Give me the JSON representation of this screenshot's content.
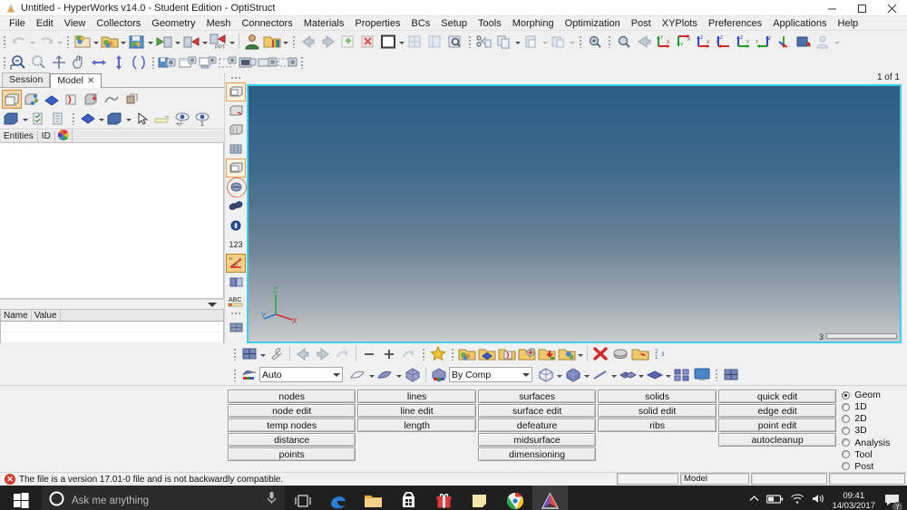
{
  "window": {
    "title": "Untitled - HyperWorks v14.0 - Student Edition - OptiStruct",
    "logo_icon": "altair-logo-icon",
    "minimize_label": "–",
    "maximize_label": "❐",
    "close_label": "✕"
  },
  "menu": {
    "items": [
      {
        "label": "File"
      },
      {
        "label": "Edit"
      },
      {
        "label": "View"
      },
      {
        "label": "Collectors"
      },
      {
        "label": "Geometry"
      },
      {
        "label": "Mesh"
      },
      {
        "label": "Connectors"
      },
      {
        "label": "Materials"
      },
      {
        "label": "Properties"
      },
      {
        "label": "BCs"
      },
      {
        "label": "Setup"
      },
      {
        "label": "Tools"
      },
      {
        "label": "Morphing"
      },
      {
        "label": "Optimization"
      },
      {
        "label": "Post"
      },
      {
        "label": "XYPlots"
      },
      {
        "label": "Preferences"
      },
      {
        "label": "Applications"
      },
      {
        "label": "Help"
      }
    ]
  },
  "toolbars": {
    "row1": [
      {
        "icon": "undo-icon"
      },
      {
        "icon": "redo-icon"
      },
      {
        "icon": "new-session-icon"
      },
      {
        "icon": "open-model-icon"
      },
      {
        "icon": "save-model-icon"
      },
      {
        "icon": "import-solver-deck-icon"
      },
      {
        "icon": "export-solver-deck-icon"
      },
      {
        "icon": "export-ppt-icon"
      },
      {
        "icon": "user-profile-icon"
      },
      {
        "icon": "color-palette-icon"
      },
      {
        "icon": "page-previous-icon"
      },
      {
        "icon": "page-next-icon"
      },
      {
        "icon": "page-add-icon"
      },
      {
        "icon": "page-delete-icon"
      },
      {
        "icon": "window-layout-icon"
      },
      {
        "icon": "window-tile-icon"
      },
      {
        "icon": "window-sync-icon"
      },
      {
        "icon": "window-overlay-icon"
      },
      {
        "icon": "cut-icon"
      },
      {
        "icon": "copy-icon"
      },
      {
        "icon": "paste-icon"
      },
      {
        "icon": "paste-special-icon"
      },
      {
        "icon": "fit-view-icon"
      }
    ],
    "row1b": [
      {
        "icon": "zoom-fit-icon"
      },
      {
        "icon": "view-previous-icon"
      },
      {
        "icon": "view-xy-icon"
      },
      {
        "icon": "view-yx-icon"
      },
      {
        "icon": "view-zx-icon"
      },
      {
        "icon": "view-xz-icon"
      },
      {
        "icon": "view-zy-icon"
      },
      {
        "icon": "view-yz-icon"
      },
      {
        "icon": "view-iso-icon"
      },
      {
        "icon": "rotate-view-icon"
      },
      {
        "icon": "user-view-icon"
      }
    ],
    "row2": [
      {
        "icon": "zoom-out-icon"
      },
      {
        "icon": "zoom-in-icon"
      },
      {
        "icon": "fit-icon"
      },
      {
        "icon": "pan-icon"
      },
      {
        "icon": "rotate-horizontal-icon"
      },
      {
        "icon": "rotate-vertical-icon"
      },
      {
        "icon": "rotate-free-icon"
      },
      {
        "icon": "capture-save-icon"
      },
      {
        "icon": "capture-window-icon"
      },
      {
        "icon": "capture-screen-icon"
      },
      {
        "icon": "capture-region-icon"
      },
      {
        "icon": "video-window-icon"
      },
      {
        "icon": "video-screen-icon"
      },
      {
        "icon": "video-region-icon"
      }
    ]
  },
  "browser": {
    "tabs": [
      {
        "label": "Session",
        "active": false,
        "closable": false
      },
      {
        "label": "Model",
        "active": true,
        "closable": true,
        "close_glyph": "✕"
      }
    ],
    "tools_row1": [
      {
        "icon": "component-icon",
        "selected": true
      },
      {
        "icon": "assembly-icon"
      },
      {
        "icon": "property-icon"
      },
      {
        "icon": "material-icon"
      },
      {
        "icon": "load-collector-icon"
      },
      {
        "icon": "curve-icon"
      },
      {
        "icon": "group-icon"
      }
    ],
    "tools_row2": [
      {
        "icon": "view-folder-icon"
      },
      {
        "icon": "check-list-icon"
      },
      {
        "icon": "collapse-list-icon"
      },
      {
        "icon": "property-display-icon"
      },
      {
        "icon": "component-display-icon"
      },
      {
        "icon": "cursor-select-icon"
      },
      {
        "icon": "highlight-icon"
      },
      {
        "icon": "show-hide-icon"
      },
      {
        "icon": "isolate-icon"
      }
    ],
    "columns": [
      {
        "label": "Entities"
      },
      {
        "label": "ID"
      },
      {
        "label": "color-wheel-icon"
      }
    ],
    "detail_columns": [
      {
        "label": "Name"
      },
      {
        "label": "Value"
      }
    ],
    "tree_items": []
  },
  "viewport_toolbar": {
    "items": [
      {
        "icon": "mesh-shaded-icon",
        "selected": true
      },
      {
        "icon": "mesh-lines-icon"
      },
      {
        "icon": "mesh-wire-icon"
      },
      {
        "icon": "mesh-grid-icon"
      },
      {
        "icon": "mesh-feature-icon",
        "selected": true
      },
      {
        "icon": "shrink-elements-icon",
        "circled": true
      },
      {
        "icon": "element-normals-icon"
      },
      {
        "icon": "node-display-icon"
      },
      {
        "icon": "element-id-icon"
      },
      {
        "icon": "measure-angle-icon",
        "selected": true
      },
      {
        "icon": "section-cut-icon"
      },
      {
        "icon": "text-annotation-icon"
      },
      {
        "icon": "mesh-panel-icon"
      }
    ]
  },
  "viewport": {
    "page_indicator": "1 of 1",
    "scroll_value": "3",
    "axis_triad": {
      "x": "X",
      "y": "Y",
      "z": "Z"
    },
    "bg_top_color": "#2c5d86",
    "bg_bottom_color": "#c9ccce",
    "border_color": "#3fd0e8"
  },
  "lower_toolbar_row1": [
    {
      "icon": "mesh-window-icon"
    },
    {
      "icon": "settings-wrench-icon"
    },
    {
      "icon": "back-arrow-icon"
    },
    {
      "icon": "forward-arrow-icon"
    },
    {
      "icon": "undo-arc-icon"
    },
    {
      "icon": "minus-icon"
    },
    {
      "icon": "plus-icon"
    },
    {
      "icon": "redo-arc-icon"
    },
    {
      "icon": "favorite-star-icon"
    },
    {
      "icon": "component-collector-icon"
    },
    {
      "icon": "property-collector-icon"
    },
    {
      "icon": "material-collector-icon"
    },
    {
      "icon": "load-collector-icon"
    },
    {
      "icon": "import-collector-icon"
    },
    {
      "icon": "export-collector-icon"
    },
    {
      "icon": "delete-red-x-icon"
    },
    {
      "icon": "mask-icon"
    },
    {
      "icon": "organize-icon"
    },
    {
      "icon": "renumber-icon"
    }
  ],
  "lower_toolbar_row2": {
    "mode_select": {
      "label": "Auto",
      "icon": "color-mode-icon",
      "caret": true
    },
    "items_left": [
      {
        "icon": "surface-shade-icon"
      },
      {
        "icon": "surface-mesh-icon"
      },
      {
        "icon": "solid-shade-icon"
      }
    ],
    "color_select": {
      "label": "By Comp",
      "icon": "color-by-icon",
      "caret": true
    },
    "items_right": [
      {
        "icon": "wireframe-cube-icon"
      },
      {
        "icon": "shaded-cube-icon"
      },
      {
        "icon": "line-display-icon"
      },
      {
        "icon": "shell-display-icon"
      },
      {
        "icon": "solid-display-icon"
      },
      {
        "icon": "exploded-view-icon"
      },
      {
        "icon": "screen-display-icon"
      },
      {
        "icon": "mesh-panel-icon"
      }
    ]
  },
  "panel": {
    "columns": [
      {
        "buttons": [
          "nodes",
          "node edit",
          "temp nodes",
          "distance",
          "points"
        ]
      },
      {
        "buttons": [
          "lines",
          "line edit",
          "length"
        ]
      },
      {
        "buttons": [
          "surfaces",
          "surface edit",
          "defeature",
          "midsurface",
          "dimensioning"
        ]
      },
      {
        "buttons": [
          "solids",
          "solid edit",
          "ribs"
        ]
      },
      {
        "buttons": [
          "quick edit",
          "edge edit",
          "point edit",
          "autocleanup"
        ]
      }
    ],
    "page_radios": [
      {
        "label": "Geom",
        "selected": true
      },
      {
        "label": "1D",
        "selected": false
      },
      {
        "label": "2D",
        "selected": false
      },
      {
        "label": "3D",
        "selected": false
      },
      {
        "label": "Analysis",
        "selected": false
      },
      {
        "label": "Tool",
        "selected": false
      },
      {
        "label": "Post",
        "selected": false
      }
    ]
  },
  "statusbar": {
    "icon": "error-icon",
    "icon_glyph": "✕",
    "message": "The file is a version 17.01-0 file and is not backwardly compatible.",
    "fields": [
      "",
      "Model",
      "",
      ""
    ]
  },
  "taskbar": {
    "start_icon": "windows-start-icon",
    "search": {
      "icon": "cortana-circle-icon",
      "placeholder": "Ask me anything",
      "mic_icon": "microphone-icon"
    },
    "task_view_icon": "task-view-icon",
    "apps": [
      {
        "icon": "edge-icon",
        "active": false
      },
      {
        "icon": "file-explorer-icon",
        "active": false
      },
      {
        "icon": "store-icon",
        "active": false
      },
      {
        "icon": "gift-icon",
        "active": false
      },
      {
        "icon": "sticky-notes-icon",
        "active": false
      },
      {
        "icon": "chrome-icon",
        "active": false
      },
      {
        "icon": "hyperworks-icon",
        "active": true
      }
    ],
    "tray": {
      "chevron_icon": "show-hidden-icons-icon",
      "battery_icon": "battery-icon",
      "wifi_icon": "wifi-icon",
      "volume_icon": "volume-icon",
      "time": "09:41",
      "date": "14/03/2017",
      "action_center_icon": "action-center-icon",
      "notification_count": "7"
    }
  }
}
